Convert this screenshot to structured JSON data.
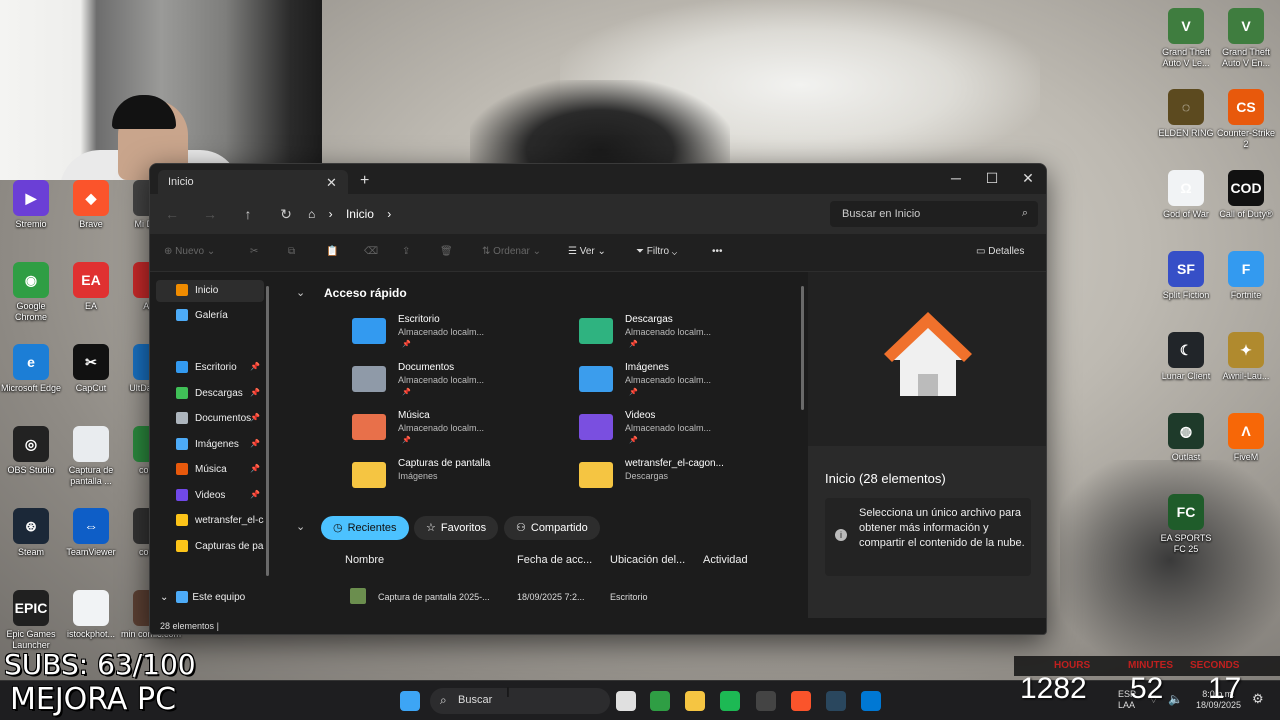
{
  "desktop": {
    "left_icons": [
      {
        "label": "Stremio",
        "icon": "stremio-icon",
        "color": "#6b3fd6",
        "glyph": "▶"
      },
      {
        "label": "Brave",
        "icon": "brave-icon",
        "color": "#fb542b",
        "glyph": "◆"
      },
      {
        "label": "Mi Diver",
        "icon": "mid-icon",
        "color": "#444444",
        "glyph": ""
      },
      {
        "label": "Google Chrome",
        "icon": "chrome-icon",
        "color": "#2f9e44",
        "glyph": "◉"
      },
      {
        "label": "EA",
        "icon": "ea-icon",
        "color": "#e03131",
        "glyph": "EA"
      },
      {
        "label": "Any",
        "icon": "any-icon",
        "color": "#c92a2a",
        "glyph": ""
      },
      {
        "label": "Microsoft Edge",
        "icon": "edge-icon",
        "color": "#1c7ed6",
        "glyph": "e"
      },
      {
        "label": "CapCut",
        "icon": "capcut-icon",
        "color": "#111111",
        "glyph": "✂"
      },
      {
        "label": "UltDat Rec",
        "icon": "ultdata-icon",
        "color": "#1971c2",
        "glyph": ""
      },
      {
        "label": "OBS Studio",
        "icon": "obs-icon",
        "color": "#222222",
        "glyph": "◎"
      },
      {
        "label": "Captura de pantalla ...",
        "icon": "screenshot-icon",
        "color": "#e9ecef",
        "glyph": ""
      },
      {
        "label": "conve",
        "icon": "convert-icon",
        "color": "#2b8a3e",
        "glyph": ""
      },
      {
        "label": "Steam",
        "icon": "steam-icon",
        "color": "#1b2838",
        "glyph": "⊛"
      },
      {
        "label": "TeamViewer",
        "icon": "teamviewer-icon",
        "color": "#0e5ec7",
        "glyph": "⇔"
      },
      {
        "label": "conve",
        "icon": "convert2-icon",
        "color": "#333333",
        "glyph": ""
      },
      {
        "label": "Epic Games Launcher",
        "icon": "epic-icon",
        "color": "#202020",
        "glyph": "EPIC"
      },
      {
        "label": "istockphot...",
        "icon": "istock-icon",
        "color": "#f1f3f5",
        "glyph": ""
      },
      {
        "label": "min comic.com",
        "icon": "minecraft-icon",
        "color": "#5c4033",
        "glyph": ""
      }
    ],
    "right_icons": [
      {
        "label": "Grand Theft Auto V Le...",
        "icon": "gta-icon",
        "color": "#3f7d3f",
        "glyph": "V"
      },
      {
        "label": "Grand Theft Auto V En...",
        "icon": "gta-enhanced-icon",
        "color": "#3f7d3f",
        "glyph": "V"
      },
      {
        "label": "ELDEN RING",
        "icon": "elden-ring-icon",
        "color": "#5c4a1f",
        "glyph": "◌"
      },
      {
        "label": "Counter-Strike 2",
        "icon": "cs2-icon",
        "color": "#e8590c",
        "glyph": "CS"
      },
      {
        "label": "God of War",
        "icon": "god-of-war-icon",
        "color": "#f1f3f5",
        "glyph": "Ω"
      },
      {
        "label": "Call of Duty®",
        "icon": "cod-icon",
        "color": "#111111",
        "glyph": "COD"
      },
      {
        "label": "Split Fiction",
        "icon": "split-fiction-icon",
        "color": "#364fc7",
        "glyph": "SF"
      },
      {
        "label": "Fortnite",
        "icon": "fortnite-icon",
        "color": "#339af0",
        "glyph": "F"
      },
      {
        "label": "Lunar Client",
        "icon": "lunar-icon",
        "color": "#212529",
        "glyph": "☾"
      },
      {
        "label": "Awnil-Lau...",
        "icon": "awnil-icon",
        "color": "#b08a2e",
        "glyph": "✦"
      },
      {
        "label": "Outlast",
        "icon": "outlast-icon",
        "color": "#1e3a2a",
        "glyph": "◍"
      },
      {
        "label": "FiveM",
        "icon": "fivem-icon",
        "color": "#f76707",
        "glyph": "Λ"
      },
      {
        "label": "EA SPORTS FC 25",
        "icon": "fc25-icon",
        "color": "#1f5c2a",
        "glyph": "FC"
      }
    ]
  },
  "explorer": {
    "tab_title": "Inicio",
    "close_tab_glyph": "✕",
    "new_tab_glyph": "+",
    "window_controls": {
      "minimize": "─",
      "maximize": "☐",
      "close": "✕"
    },
    "nav": {
      "back": "←",
      "forward": "→",
      "up": "↑",
      "refresh": "↻"
    },
    "breadcrumb": {
      "home_glyph": "⌂",
      "sep": "›",
      "location": "Inicio"
    },
    "search_placeholder": "Buscar en Inicio",
    "search_glyph": "⌕",
    "toolbar": {
      "new_label": "Nuevo",
      "sort_label": "Ordenar",
      "view_label": "Ver",
      "filter_label": "Filtro",
      "more_label": "•••",
      "details_label": "Detalles",
      "cut": "✂",
      "copy": "⧉",
      "paste": "📋",
      "rename": "⌫",
      "share": "⇪",
      "delete": "🗑"
    },
    "sidebar": {
      "top": [
        {
          "label": "Inicio",
          "color": "#f08c00",
          "active": true
        },
        {
          "label": "Galería",
          "color": "#4dabf7",
          "active": false
        }
      ],
      "pinned": [
        {
          "label": "Escritorio",
          "color": "#339af0"
        },
        {
          "label": "Descargas",
          "color": "#40c057"
        },
        {
          "label": "Documentos",
          "color": "#adb5bd"
        },
        {
          "label": "Imágenes",
          "color": "#4dabf7"
        },
        {
          "label": "Música",
          "color": "#e8590c"
        },
        {
          "label": "Videos",
          "color": "#7048e8"
        },
        {
          "label": "wetransfer_el-ca",
          "color": "#fcc419"
        },
        {
          "label": "Capturas de par",
          "color": "#fcc419"
        }
      ],
      "pin_glyph": "📌",
      "this_pc": "Este equipo",
      "this_pc_chevron": "⌄"
    },
    "quick_access": {
      "title": "Acceso rápido",
      "chevron": "⌄",
      "items": [
        {
          "name": "Escritorio",
          "sub": "Almacenado localm...",
          "pinned": true,
          "color": "#339af0"
        },
        {
          "name": "Descargas",
          "sub": "Almacenado localm...",
          "pinned": true,
          "color": "#2fb380"
        },
        {
          "name": "Documentos",
          "sub": "Almacenado localm...",
          "pinned": true,
          "color": "#8f9aa8"
        },
        {
          "name": "Imágenes",
          "sub": "Almacenado localm...",
          "pinned": true,
          "color": "#3b9ded"
        },
        {
          "name": "Música",
          "sub": "Almacenado localm...",
          "pinned": true,
          "color": "#e8704a"
        },
        {
          "name": "Videos",
          "sub": "Almacenado localm...",
          "pinned": true,
          "color": "#7a4fe0"
        },
        {
          "name": "Capturas de pantalla",
          "sub": "Imágenes",
          "pinned": false,
          "color": "#f5c542"
        },
        {
          "name": "wetransfer_el-cagon...",
          "sub": "Descargas",
          "pinned": false,
          "color": "#f5c542"
        }
      ]
    },
    "filters": [
      {
        "label": "Recientes",
        "glyph": "◷",
        "active": true
      },
      {
        "label": "Favoritos",
        "glyph": "☆",
        "active": false
      },
      {
        "label": "Compartido",
        "glyph": "⚇",
        "active": false
      }
    ],
    "columns": [
      "Nombre",
      "Fecha de acc...",
      "Ubicación del...",
      "Actividad"
    ],
    "rows": [
      {
        "name": "Captura de pantalla 2025-...",
        "date": "18/09/2025 7:2...",
        "location": "Escritorio"
      }
    ],
    "details": {
      "title": "Inicio (28 elementos)",
      "info_glyph": "i",
      "message": "Selecciona un único archivo para obtener más información y compartir el contenido de la nube."
    },
    "status": "28 elementos"
  },
  "overlay": {
    "subs": "SUBS: 63/100",
    "brand": "MEJORA PC",
    "timer": {
      "labels": [
        "HOURS",
        "MINUTES",
        "SECONDS"
      ],
      "values": [
        "1282",
        "52",
        "17"
      ],
      "label_color": "#c0201f"
    }
  },
  "taskbar": {
    "search_label": "Buscar",
    "search_glyph": "⌕",
    "apps": [
      {
        "icon": "windows-start-icon",
        "color": "#3da5f5"
      },
      {
        "icon": "taskview-icon",
        "color": "#e0e0e0"
      },
      {
        "icon": "chrome-taskbar-icon",
        "color": "#2f9e44"
      },
      {
        "icon": "explorer-taskbar-icon",
        "color": "#f5c542"
      },
      {
        "icon": "spotify-icon",
        "color": "#1db954"
      },
      {
        "icon": "obs-taskbar-icon",
        "color": "#444444"
      },
      {
        "icon": "brave-taskbar-icon",
        "color": "#fb542b"
      },
      {
        "icon": "steam-taskbar-icon",
        "color": "#2a475e"
      },
      {
        "icon": "store-icon",
        "color": "#0078d4"
      }
    ],
    "tray": {
      "lang_top": "ESP",
      "lang_bottom": "LAA",
      "time": "8:0 p.m.",
      "date": "18/09/2025"
    }
  }
}
